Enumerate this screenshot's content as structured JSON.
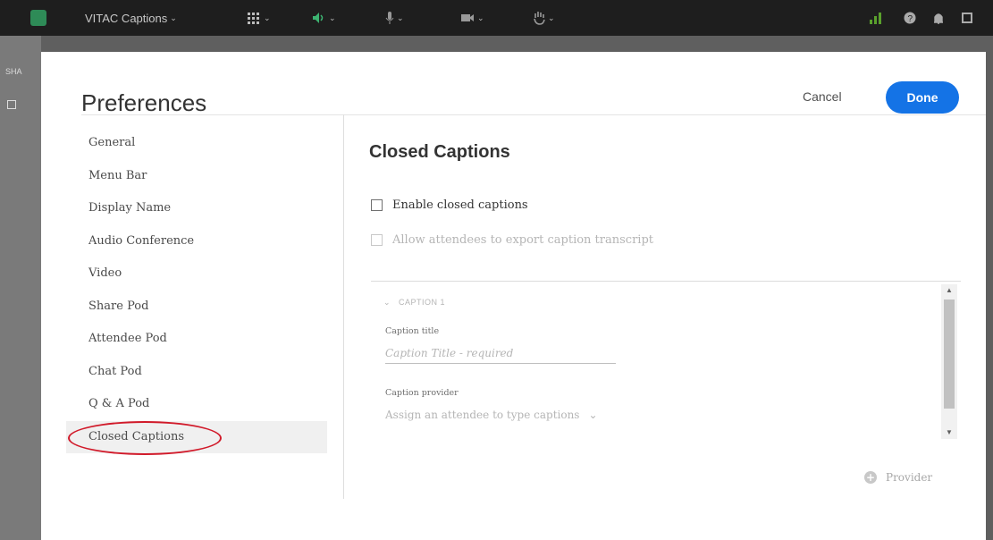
{
  "topbar": {
    "app_name": "VITAC Captions",
    "chevron": "⌄"
  },
  "backdrop": {
    "share_label": "SHA"
  },
  "dialog": {
    "title": "Preferences",
    "cancel_label": "Cancel",
    "done_label": "Done"
  },
  "nav": {
    "items": [
      {
        "label": "General"
      },
      {
        "label": "Menu Bar"
      },
      {
        "label": "Display Name"
      },
      {
        "label": "Audio Conference"
      },
      {
        "label": "Video"
      },
      {
        "label": "Share Pod"
      },
      {
        "label": "Attendee Pod"
      },
      {
        "label": "Chat Pod"
      },
      {
        "label": "Q & A Pod"
      },
      {
        "label": "Closed Captions"
      }
    ],
    "selected": "Closed Captions"
  },
  "content": {
    "section_title": "Closed Captions",
    "enable_label": "Enable closed captions",
    "enable_checked": false,
    "export_label": "Allow attendees to export caption transcript",
    "export_checked": false,
    "caption": {
      "header": "CAPTION 1",
      "title_label": "Caption title",
      "title_placeholder": "Caption Title - required",
      "title_value": "",
      "provider_label": "Caption provider",
      "provider_value": "Assign an attendee to type captions"
    },
    "add_provider_label": "Provider"
  },
  "colors": {
    "accent": "#1473e6",
    "topbar": "#1e1e1e",
    "highlight_ring": "#d11a2a"
  }
}
